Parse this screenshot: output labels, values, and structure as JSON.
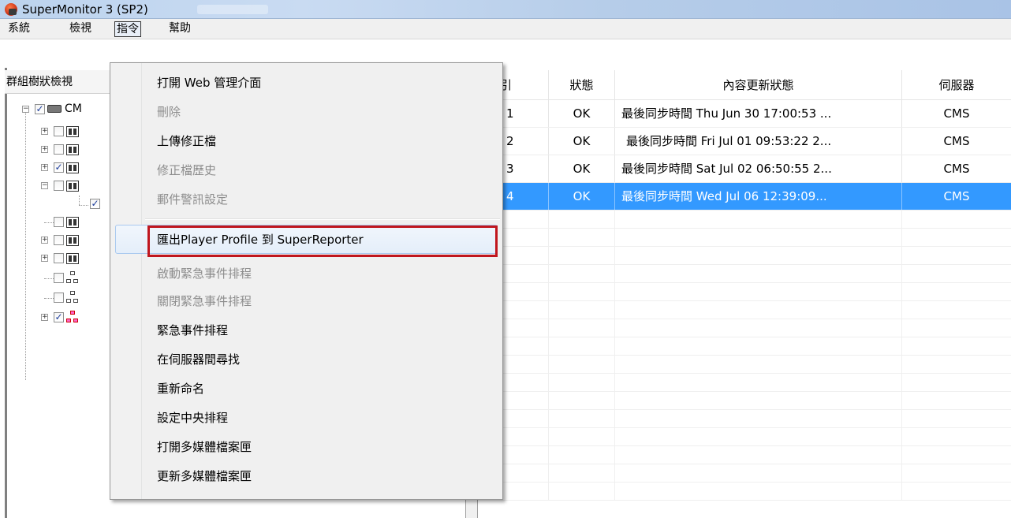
{
  "window": {
    "title": "SuperMonitor 3 (SP2)"
  },
  "menubar": {
    "items": [
      {
        "label": "系統"
      },
      {
        "label": "檢視"
      },
      {
        "label": "指令"
      },
      {
        "label": "幫助"
      }
    ]
  },
  "tree_panel": {
    "header": "群組樹狀檢視",
    "root_label": "CM"
  },
  "grid": {
    "columns": [
      "引",
      "狀態",
      "內容更新狀態",
      "伺服器"
    ],
    "rows": [
      {
        "index": "1",
        "status": "OK",
        "sync": "最後同步時間 Thu Jun 30 17:00:53 ...",
        "server": "CMS"
      },
      {
        "index": "2",
        "status": "OK",
        "sync": "最後同步時間 Fri Jul 01 09:53:22 2...",
        "server": "CMS"
      },
      {
        "index": "3",
        "status": "OK",
        "sync": "最後同步時間 Sat Jul 02 06:50:55 2...",
        "server": "CMS"
      },
      {
        "index": "4",
        "status": "OK",
        "sync": "最後同步時間 Wed Jul 06 12:39:09...",
        "server": "CMS",
        "selected": true
      }
    ]
  },
  "command_menu": {
    "items": [
      {
        "label": "打開 Web 管理介面",
        "enabled": true
      },
      {
        "label": "刪除",
        "enabled": false
      },
      {
        "label": "上傳修正檔",
        "enabled": true
      },
      {
        "label": "修正檔歷史",
        "enabled": false
      },
      {
        "label": "郵件警訊設定",
        "enabled": false
      },
      {
        "label": "匯出Player Profile 到 SuperReporter",
        "enabled": true,
        "highlighted": true
      },
      {
        "label": "啟動緊急事件排程",
        "enabled": false
      },
      {
        "label": "關閉緊急事件排程",
        "enabled": false
      },
      {
        "label": "緊急事件排程",
        "enabled": true
      },
      {
        "label": "在伺服器間尋找",
        "enabled": true
      },
      {
        "label": "重新命名",
        "enabled": true
      },
      {
        "label": "設定中央排程",
        "enabled": true
      },
      {
        "label": "打開多媒體檔案匣",
        "enabled": true
      },
      {
        "label": "更新多媒體檔案匣",
        "enabled": true
      }
    ]
  },
  "colors": {
    "selection": "#3399ff",
    "callout_border": "#c0161e"
  }
}
